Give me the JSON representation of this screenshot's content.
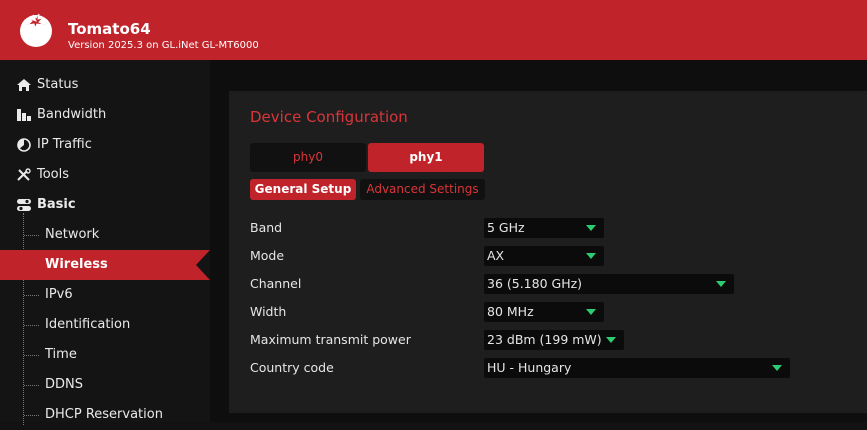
{
  "header": {
    "title": "Tomato64",
    "version": "Version 2025.3 on GL.iNet GL-MT6000",
    "logo_icon": "tomato-icon",
    "accent": "#c0232a"
  },
  "sidebar": {
    "items": [
      {
        "label": "Status",
        "icon": "home-icon"
      },
      {
        "label": "Bandwidth",
        "icon": "bar-chart-icon"
      },
      {
        "label": "IP Traffic",
        "icon": "pie-chart-icon"
      },
      {
        "label": "Tools",
        "icon": "tools-icon"
      },
      {
        "label": "Basic",
        "icon": "toggle-icon"
      }
    ],
    "subitems": [
      {
        "label": "Network"
      },
      {
        "label": "Wireless",
        "active": true
      },
      {
        "label": "IPv6"
      },
      {
        "label": "Identification"
      },
      {
        "label": "Time"
      },
      {
        "label": "DDNS"
      },
      {
        "label": "DHCP Reservation"
      }
    ]
  },
  "main": {
    "title": "Device Configuration",
    "phy_tabs": [
      {
        "label": "phy0",
        "active": false
      },
      {
        "label": "phy1",
        "active": true
      }
    ],
    "sub_tabs": [
      {
        "label": "General Setup",
        "active": true
      },
      {
        "label": "Advanced Settings",
        "active": false
      }
    ],
    "fields": [
      {
        "label": "Band",
        "value": "5 GHz"
      },
      {
        "label": "Mode",
        "value": "AX"
      },
      {
        "label": "Channel",
        "value": "36 (5.180 GHz)"
      },
      {
        "label": "Width",
        "value": "80 MHz"
      },
      {
        "label": "Maximum transmit power",
        "value": "23 dBm (199 mW)"
      },
      {
        "label": "Country code",
        "value": "HU - Hungary"
      }
    ]
  }
}
